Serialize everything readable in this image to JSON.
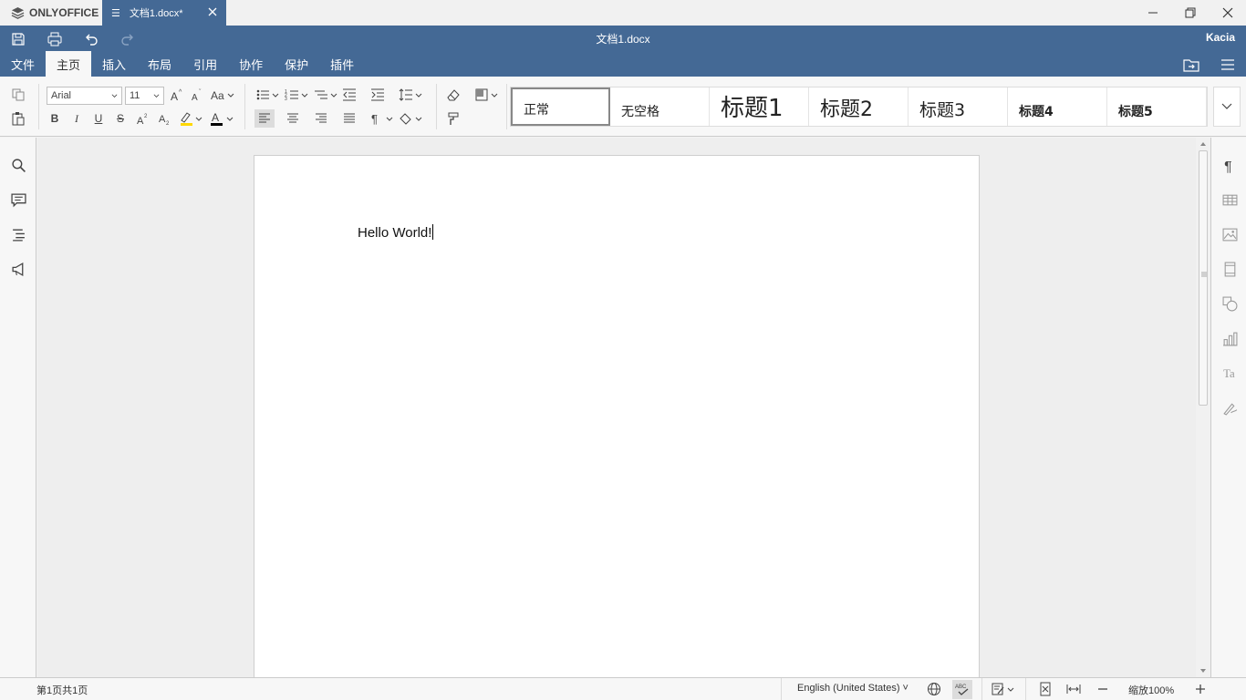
{
  "app": {
    "name": "ONLYOFFICE"
  },
  "tab": {
    "title": "文档1.docx*"
  },
  "window": {
    "title": "文档1.docx",
    "user": "Kacia"
  },
  "menu": {
    "tabs": [
      "文件",
      "主页",
      "插入",
      "布局",
      "引用",
      "协作",
      "保护",
      "插件"
    ],
    "active": "主页"
  },
  "font": {
    "family": "Arial",
    "size": "11"
  },
  "styles": [
    "正常",
    "无空格",
    "标题1",
    "标题2",
    "标题3",
    "标题4",
    "标题5"
  ],
  "document": {
    "text": "Hello World!"
  },
  "status": {
    "page_info": "第1页共1页",
    "language": "English (United States)",
    "zoom": "缩放100%"
  },
  "colors": {
    "header": "#446995",
    "highlight": "#ffd800",
    "font_color": "#000000"
  }
}
